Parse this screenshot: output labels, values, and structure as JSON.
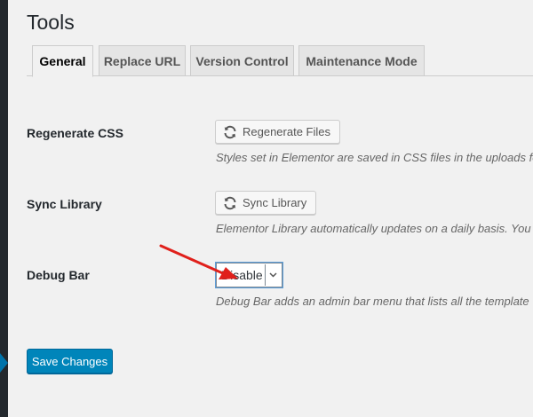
{
  "page": {
    "title": "Tools"
  },
  "tabs": [
    {
      "label": "General",
      "active": true
    },
    {
      "label": "Replace URL"
    },
    {
      "label": "Version Control"
    },
    {
      "label": "Maintenance Mode"
    }
  ],
  "settings": {
    "regenerate": {
      "label": "Regenerate CSS",
      "button": "Regenerate Files",
      "button_icon": "sync-icon",
      "description": "Styles set in Elementor are saved in CSS files in the uploads fo"
    },
    "sync": {
      "label": "Sync Library",
      "button": "Sync Library",
      "button_icon": "sync-icon",
      "description": "Elementor Library automatically updates on a daily basis. You"
    },
    "debug": {
      "label": "Debug Bar",
      "select_value": "Disable",
      "description": "Debug Bar adds an admin bar menu that lists all the template"
    }
  },
  "footer": {
    "save_label": "Save Changes"
  },
  "colors": {
    "primary": "#0085ba",
    "sidebar": "#23282d",
    "annotation_arrow": "#e0201b"
  }
}
